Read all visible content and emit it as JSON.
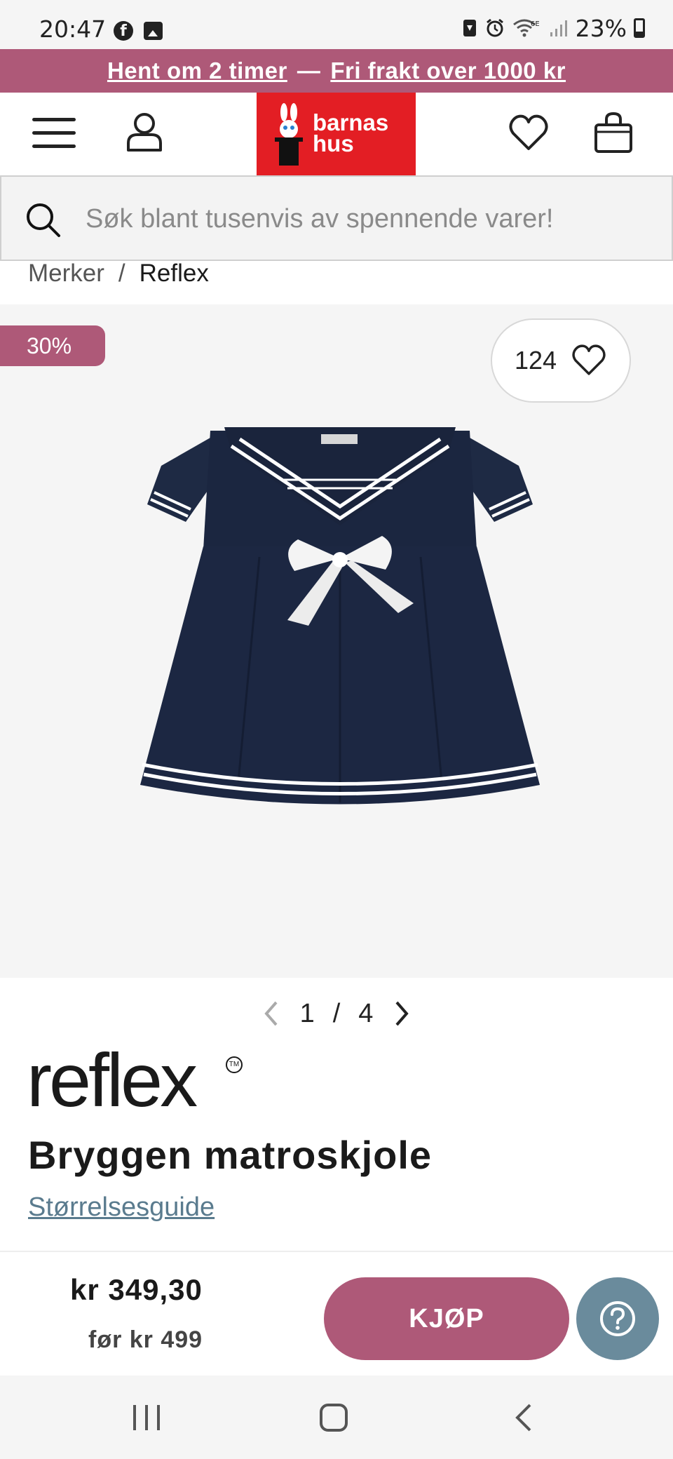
{
  "status_bar": {
    "time": "20:47",
    "battery": "23%",
    "icons": [
      "facebook-icon",
      "gallery-icon",
      "storage-icon",
      "alarm-icon",
      "wifi-6e-icon",
      "signal-icon",
      "battery-icon"
    ]
  },
  "promo": {
    "link1": "Hent om 2 timer",
    "separator": "—",
    "link2": "Fri frakt over 1000 kr",
    "color": "#ae5978"
  },
  "header": {
    "logo_line1": "barnas",
    "logo_line2": "hus",
    "logo_color": "#e31e24",
    "icons": [
      "menu-icon",
      "user-icon",
      "heart-icon",
      "bag-icon"
    ]
  },
  "search": {
    "placeholder": "Søk blant tusenvis av spennende varer!",
    "value": ""
  },
  "breadcrumb": {
    "items": [
      "Merker",
      "Reflex"
    ],
    "separator": "/"
  },
  "gallery": {
    "discount": "30%",
    "favorites_count": "124",
    "current": "1",
    "separator": "/",
    "total": "4"
  },
  "product": {
    "brand": "reflex",
    "brand_mark": "TM",
    "title": "Bryggen matroskjole",
    "size_guide": "Størrelsesguide"
  },
  "buy": {
    "price": "kr 349,30",
    "before_price": "før kr 499",
    "button_label": "KJØP",
    "button_color": "#ae5978",
    "help_color": "#6a8b9c"
  }
}
